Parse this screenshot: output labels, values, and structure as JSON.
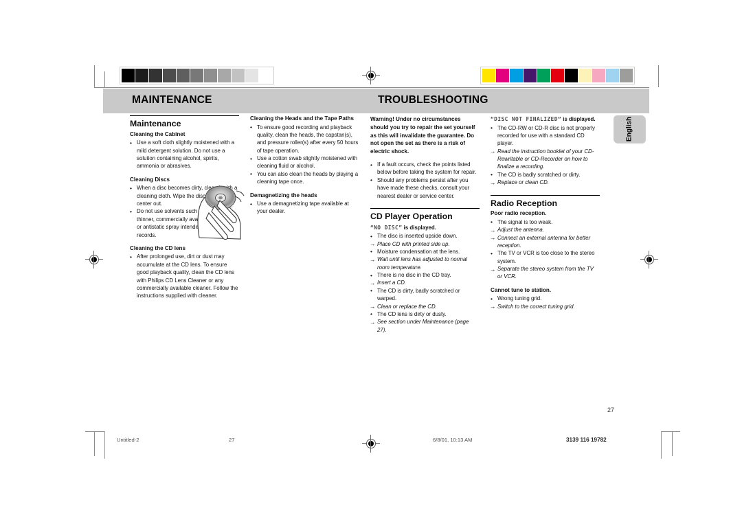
{
  "document": {
    "page_number": "27",
    "side_tab": "English"
  },
  "header": {
    "left_title": "MAINTENANCE",
    "right_title": "TROUBLESHOOTING"
  },
  "calibration": {
    "grayscale": [
      "#000000",
      "#1c1c1c",
      "#333333",
      "#4d4d4d",
      "#5f5f5f",
      "#787878",
      "#8f8f8f",
      "#a8a8a8",
      "#c2c2c2",
      "#e4e4e4",
      "#ffffff"
    ],
    "color": [
      "#ffe500",
      "#e2007e",
      "#009ee3",
      "#46166b",
      "#00a05a",
      "#e3000f",
      "#000000",
      "#fdf3b8",
      "#f5a8c0",
      "#9fd4f0",
      "#9d9d9c"
    ]
  },
  "columns": [
    {
      "id": "col-maintenance",
      "section_title": "Maintenance",
      "blocks": [
        {
          "heading": "Cleaning the Cabinet",
          "items": [
            {
              "type": "bullet",
              "text": "Use a soft cloth slightly moistened with a mild detergent solution. Do not use a solution containing alcohol, spirits, ammonia or abrasives."
            }
          ]
        },
        {
          "heading": "Cleaning Discs",
          "items": [
            {
              "type": "bullet",
              "text": "When a disc becomes dirty, clean it with a cleaning cloth. Wipe the disc from the center out."
            },
            {
              "type": "bullet",
              "text": "Do not use solvents such as benzine, thinner, commercially available cleaners, or antistatic spray intended for analog records."
            }
          ]
        },
        {
          "heading": "Cleaning the CD lens",
          "items": [
            {
              "type": "bullet",
              "text": "After prolonged use, dirt or dust may accumulate at the CD lens. To ensure good playback quality, clean the CD lens with Philips CD Lens Cleaner or any commercially available cleaner. Follow the instructions supplied with cleaner."
            }
          ]
        }
      ]
    },
    {
      "id": "col-heads",
      "blocks": [
        {
          "heading": "Cleaning the Heads and the Tape Paths",
          "items": [
            {
              "type": "bullet",
              "text": "To ensure good recording and playback quality, clean the heads, the capstan(s), and pressure roller(s) after every 50 hours of tape operation."
            },
            {
              "type": "bullet",
              "text": "Use a cotton swab slightly moistened with cleaning fluid or alcohol."
            },
            {
              "type": "bullet",
              "text": "You can also clean the heads by playing a cleaning tape once."
            }
          ]
        },
        {
          "heading": "Demagnetizing the heads",
          "items": [
            {
              "type": "bullet",
              "text": "Use a demagnetizing tape available at your dealer."
            }
          ]
        }
      ]
    },
    {
      "id": "col-troubleshooting",
      "warning": "Warning!  Under no circumstances should you try to repair the set yourself as this will invalidate the guarantee. Do not open the set as there is a risk of electric shock.",
      "warning_items": [
        {
          "type": "bullet",
          "text": "If a fault occurs, check the points listed below before taking the system for repair."
        },
        {
          "type": "bullet",
          "text": "Should any problems persist after you have made these checks, consult your nearest dealer or service center."
        }
      ],
      "section_title": "CD Player Operation",
      "blocks": [
        {
          "heading_lcd": "NO DISC",
          "heading_suffix": " is displayed.",
          "items": [
            {
              "type": "bullet",
              "text": "The disc is inserted upside down."
            },
            {
              "type": "arrow",
              "text": "Place CD with printed side up."
            },
            {
              "type": "bullet",
              "text": "Moisture condensation at the lens."
            },
            {
              "type": "arrow",
              "text": "Wait until lens has adjusted to normal room temperature."
            },
            {
              "type": "bullet",
              "text": "There is no disc in the CD tray."
            },
            {
              "type": "arrow",
              "text": "Insert a CD."
            },
            {
              "type": "bullet",
              "text": "The CD is dirty, badly scratched or warped."
            },
            {
              "type": "arrow",
              "text": "Clean or replace the CD."
            },
            {
              "type": "bullet",
              "text": "The CD lens is dirty or dusty."
            },
            {
              "type": "arrow",
              "text": "See section under Maintenance (page 27)."
            }
          ]
        }
      ]
    },
    {
      "id": "col-radio",
      "blocks": [
        {
          "heading_lcd": "“DISC NOT FINALIZED”",
          "heading_suffix": " is displayed.",
          "items": [
            {
              "type": "bullet",
              "text": "The CD-RW or CD-R disc is not properly recorded for use with a standard CD player."
            },
            {
              "type": "arrow",
              "text": "Read the instruction booklet of your CD-Rewritable or CD-Recorder on how to finalize a recording."
            },
            {
              "type": "bullet",
              "text": "The CD is badly scratched or dirty."
            },
            {
              "type": "arrow",
              "text": "Replace or clean CD."
            }
          ]
        }
      ],
      "section_title": "Radio Reception",
      "blocks2": [
        {
          "heading": "Poor radio reception.",
          "items": [
            {
              "type": "bullet",
              "text": "The signal is too weak."
            },
            {
              "type": "arrow",
              "text": "Adjust the antenna."
            },
            {
              "type": "arrow",
              "text": "Connect an external antenna for better reception."
            },
            {
              "type": "bullet",
              "text": "The TV or VCR is too close to the stereo system."
            },
            {
              "type": "arrow",
              "text": "Separate the stereo system from the TV or VCR."
            }
          ]
        },
        {
          "heading": "Cannot tune to station.",
          "items": [
            {
              "type": "bullet",
              "text": "Wrong tuning grid."
            },
            {
              "type": "arrow",
              "text": "Switch to the correct tuning grid."
            }
          ]
        }
      ]
    }
  ],
  "footer": {
    "file_name": "Untitled-2",
    "page_label": "27",
    "timestamp": "6/8/01, 10:13 AM",
    "doc_code": "3139 116 19782"
  }
}
